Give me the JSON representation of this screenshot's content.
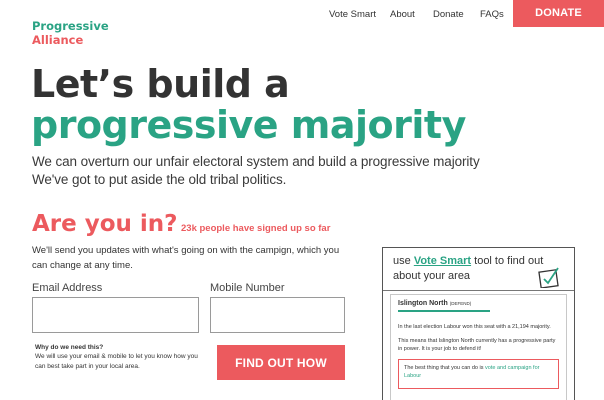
{
  "brand": {
    "line1": "Progressive",
    "line2": "Alliance"
  },
  "nav": {
    "items": [
      "Vote Smart",
      "About",
      "Donate",
      "FAQs"
    ],
    "donate": "DONATE"
  },
  "hero": {
    "line1": "Let’s build a",
    "line2": "progressive majority",
    "sub1": "We can overturn our unfair electoral system and build a progressive majority",
    "sub2": "We've got to put aside the old tribal politics."
  },
  "signup": {
    "heading": "Are you in?",
    "count": "23k people have signed up so far",
    "info": "We'll send you updates with what's going on with the campign, which you can change at any time.",
    "email_label": "Email Address",
    "email_value": "",
    "mobile_label": "Mobile Number",
    "mobile_value": "",
    "why_title": "Why do we need this?",
    "why_body": "We will use your email & mobile to let you know how you can best take part in your local area.",
    "cta": "FIND OUT HOW"
  },
  "card": {
    "pre": "use",
    "link": "Vote Smart",
    "post": "tool to find out about your area",
    "seat": "Islington North",
    "seat_tag": "(DEFEND)",
    "p1": "In the last election Labour won this seat with a 21,194 majority.",
    "p2": "This means that Islington North currently has a progressive party in power. It is your job to defend it!",
    "best_pre": "The best thing that you can do is",
    "best_link": "vote and campaign for Labour"
  },
  "colors": {
    "teal": "#2aa384",
    "coral": "#ec5a5e",
    "text": "#333333"
  }
}
